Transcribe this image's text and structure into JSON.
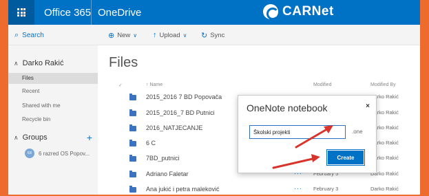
{
  "suite": {
    "app_name": "Office 365",
    "product": "OneDrive",
    "brand": "CARNet"
  },
  "commands": {
    "search": "Search",
    "new": "New",
    "upload": "Upload",
    "sync": "Sync"
  },
  "nav": {
    "user": "Darko Rakić",
    "items": [
      "Files",
      "Recent",
      "Shared with me",
      "Recycle bin"
    ],
    "groups_label": "Groups",
    "group_item": {
      "avatar": "6R",
      "label": "6 razred OS Popov..."
    }
  },
  "main": {
    "title": "Files",
    "columns": {
      "check": "✓",
      "name": "↑ Name",
      "modified": "Modified",
      "modified_by": "Modified By"
    },
    "rows": [
      {
        "name": "2015_2016 7 BD Popovača",
        "modified": "",
        "by": "Darko Rakić",
        "dots": ""
      },
      {
        "name": "2015_2016_7 BD Putnici",
        "modified": "",
        "by": "Darko Rakić",
        "dots": ""
      },
      {
        "name": "2016_NATJECANJE",
        "modified": "",
        "by": "Darko Rakić",
        "dots": ""
      },
      {
        "name": "6 C",
        "modified": "",
        "by": "Darko Rakić",
        "dots": ""
      },
      {
        "name": "7BD_putnici",
        "modified": "",
        "by": "Darko Rakić",
        "dots": ""
      },
      {
        "name": "Adriano Faletar",
        "modified": "February 5",
        "by": "Darko Rakić",
        "dots": "···"
      },
      {
        "name": "Ana jukić i petra maleković",
        "modified": "February 3",
        "by": "Darko Rakić",
        "dots": "···"
      }
    ]
  },
  "dialog": {
    "title": "OneNote notebook",
    "close": "×",
    "input_value": "Školski projekti",
    "extension": ".one",
    "create": "Create"
  },
  "colors": {
    "frame": "#ed6b2d",
    "suitebar": "#0072c6",
    "accent": "#0072c6",
    "arrow": "#d9342b"
  }
}
